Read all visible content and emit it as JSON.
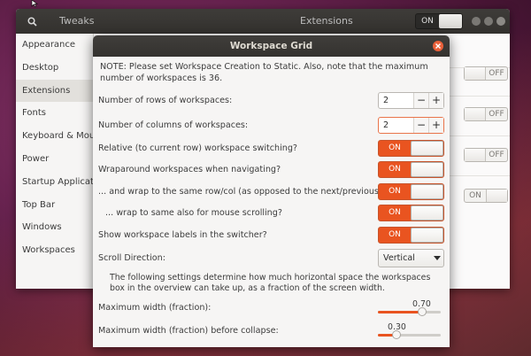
{
  "tweaks": {
    "title": "Tweaks",
    "section_title": "Extensions",
    "extensions_switch": "ON",
    "sidebar": [
      {
        "label": "Appearance"
      },
      {
        "label": "Desktop"
      },
      {
        "label": "Extensions"
      },
      {
        "label": "Fonts"
      },
      {
        "label": "Keyboard & Mouse"
      },
      {
        "label": "Power"
      },
      {
        "label": "Startup Applications"
      },
      {
        "label": "Top Bar"
      },
      {
        "label": "Windows"
      },
      {
        "label": "Workspaces"
      }
    ],
    "background_toggles": [
      "OFF",
      "OFF",
      "OFF",
      "ON"
    ]
  },
  "dialog": {
    "title": "Workspace Grid",
    "note": "NOTE: Please set Workspace Creation to Static. Also, note that the maximum number of workspaces is 36.",
    "rows_label": "Number of rows of workspaces:",
    "rows_value": "2",
    "columns_label": "Number of columns of workspaces:",
    "columns_value": "2",
    "spin_minus": "−",
    "spin_plus": "+",
    "relative_label": "Relative (to current row) workspace switching?",
    "relative_value": "ON",
    "wraparound_label": "Wraparound workspaces when navigating?",
    "wraparound_value": "ON",
    "wrap_same_label": "... and wrap to the same row/col (as opposed to the next/previous)?",
    "wrap_same_value": "ON",
    "wrap_scroll_label": "... wrap to same also for mouse scrolling?",
    "wrap_scroll_value": "ON",
    "labels_label": "Show workspace labels in the switcher?",
    "labels_value": "ON",
    "scroll_label": "Scroll Direction:",
    "scroll_value": "Vertical",
    "info": "The following settings determine how much horizontal space the workspaces box in the overview can take up, as a fraction of the screen width.",
    "max_width_label": "Maximum width (fraction):",
    "max_width_value": "0.70",
    "max_width_fraction": 0.7,
    "max_collapse_label": "Maximum width (fraction) before collapse:",
    "max_collapse_value": "0.30",
    "max_collapse_fraction": 0.3
  },
  "colors": {
    "accent": "#e95420",
    "header": "#3a3835"
  }
}
